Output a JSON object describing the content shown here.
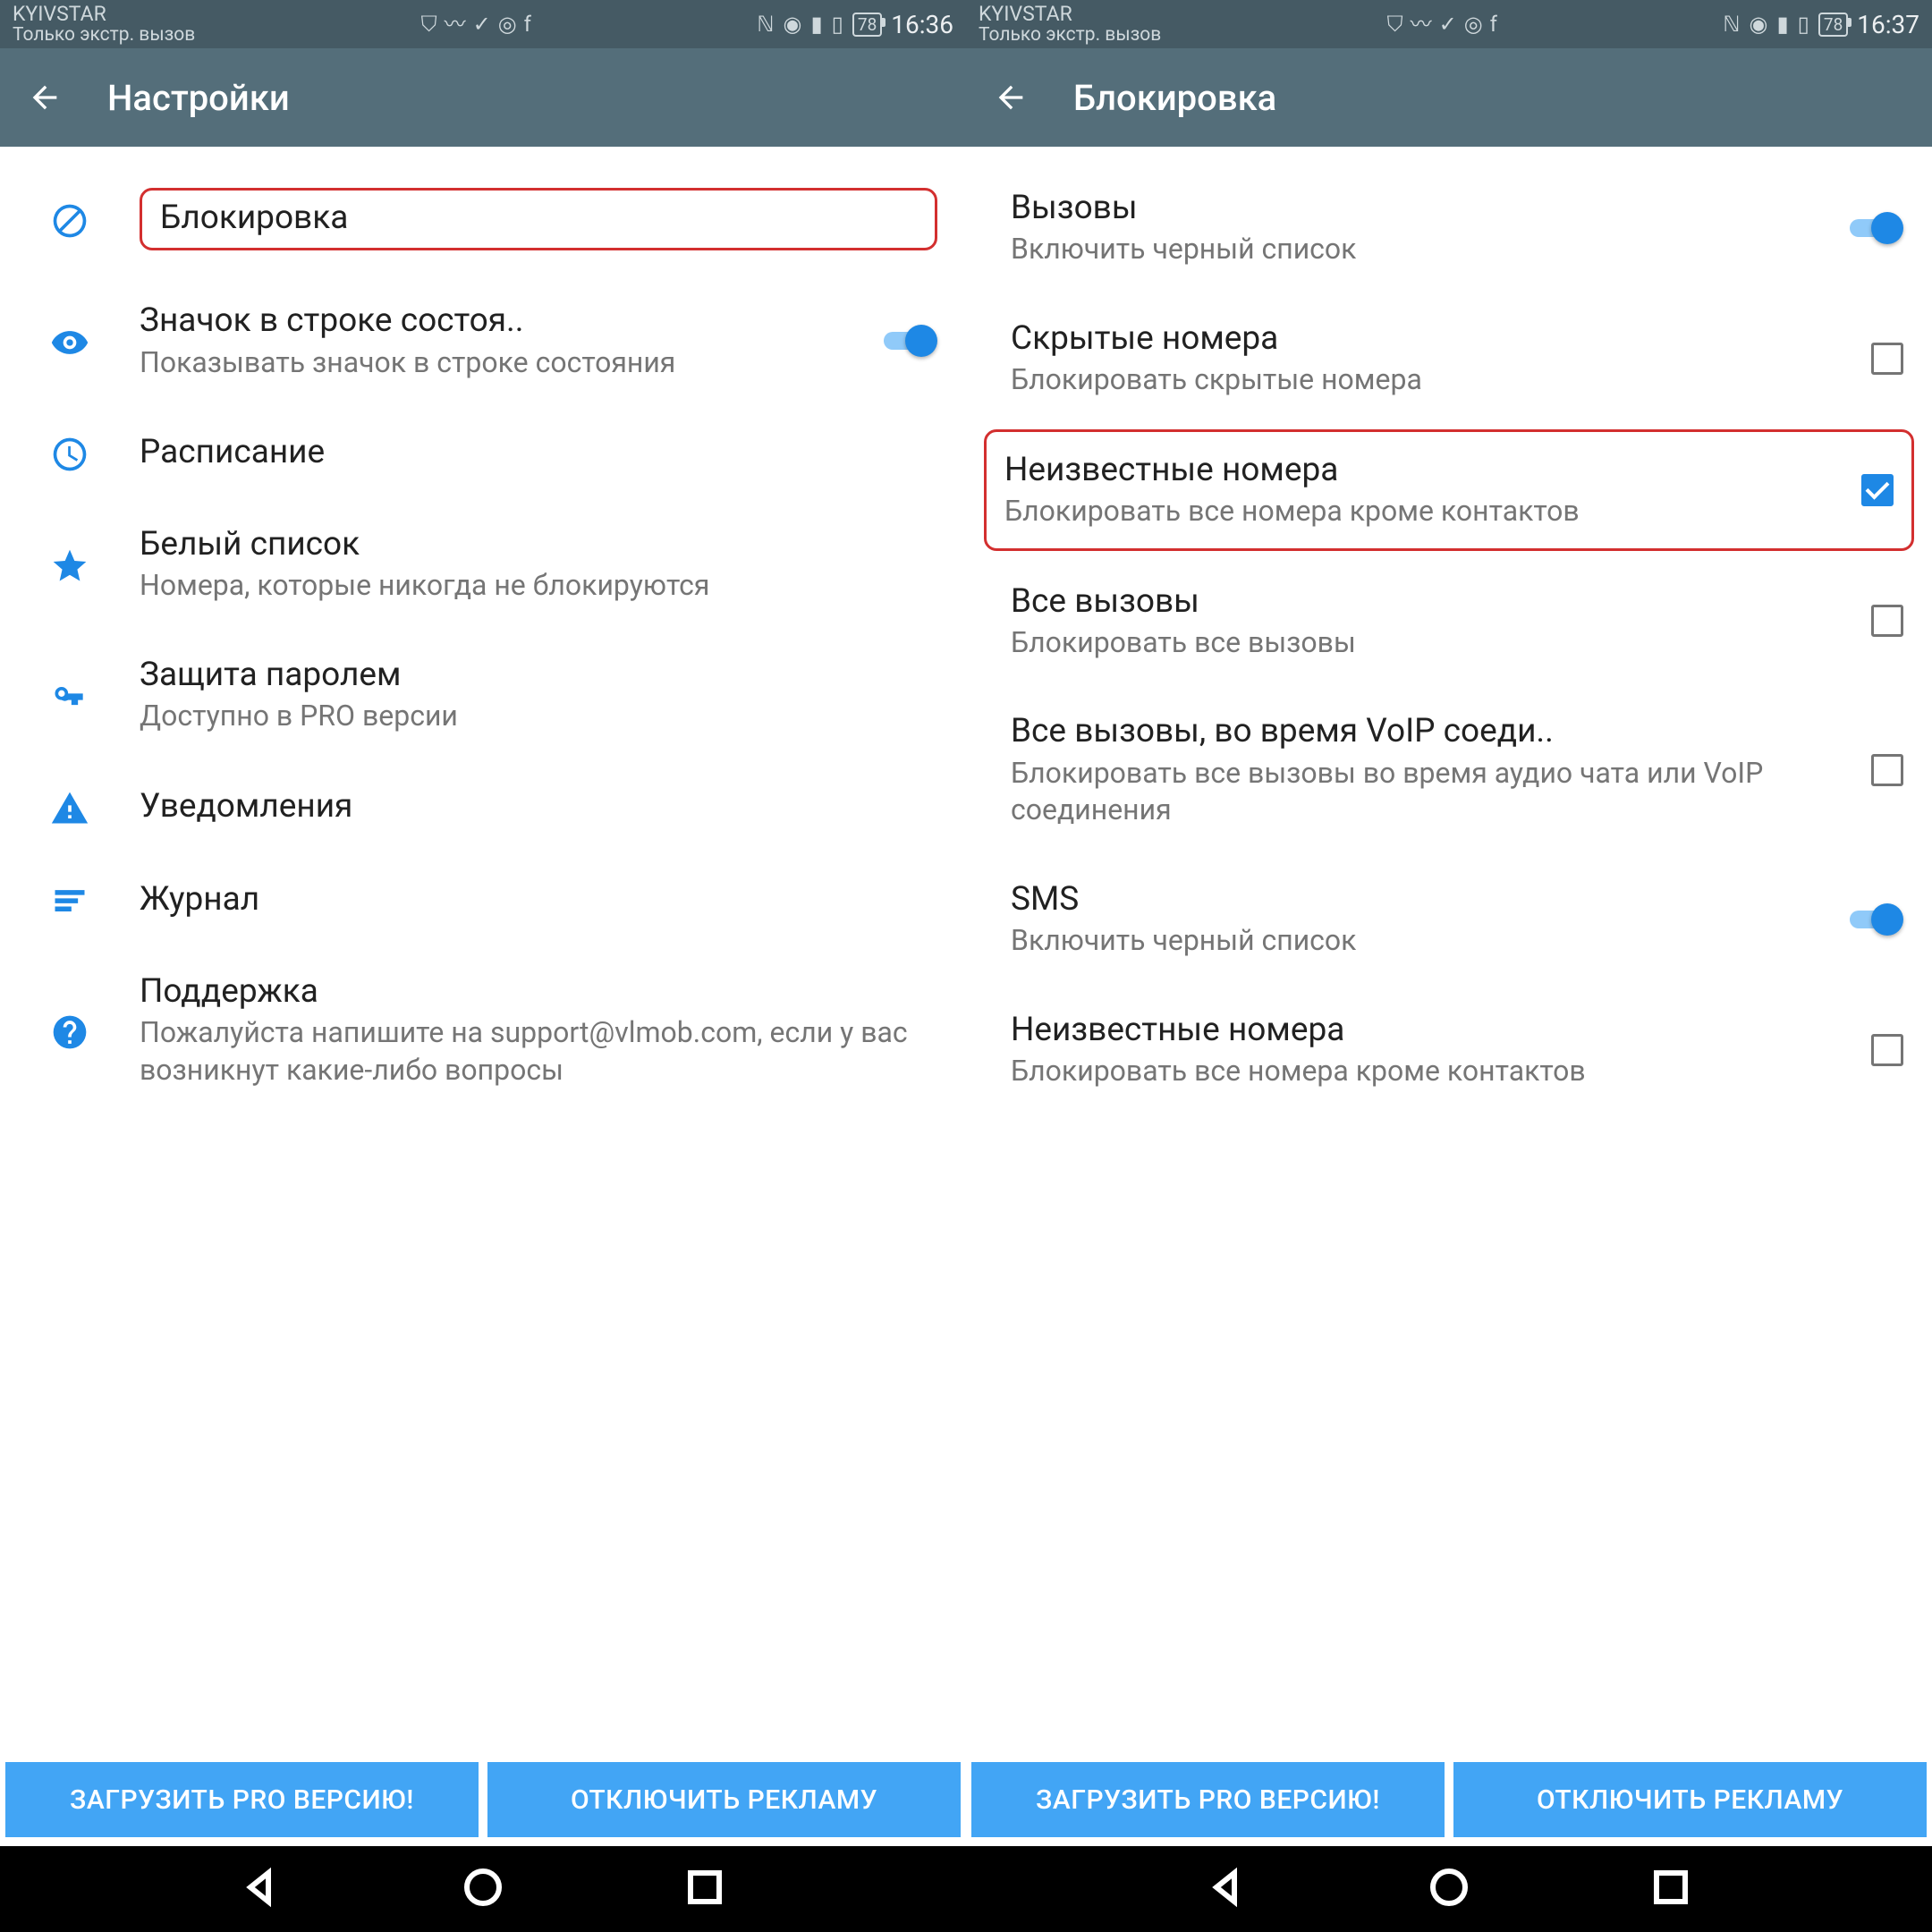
{
  "left": {
    "status": {
      "carrier": "KYIVSTAR",
      "sub": "Только экстр. вызов",
      "battery": "78",
      "time": "16:36"
    },
    "appbar_title": "Настройки",
    "items": [
      {
        "title": "Блокировка",
        "sub": "",
        "icon": "block",
        "highlighted": true
      },
      {
        "title": "Значок в строке состоя..",
        "sub": "Показывать значок в строке состояния",
        "icon": "eye",
        "toggle": true
      },
      {
        "title": "Расписание",
        "sub": "",
        "icon": "clock"
      },
      {
        "title": "Белый список",
        "sub": "Номера, которые никогда не блокируются",
        "icon": "star"
      },
      {
        "title": "Защита паролем",
        "sub": "Доступно в PRO версии",
        "icon": "key"
      },
      {
        "title": "Уведомления",
        "sub": "",
        "icon": "warning"
      },
      {
        "title": "Журнал",
        "sub": "",
        "icon": "list"
      },
      {
        "title": "Поддержка",
        "sub": "Пожалуйста напишите на support@vlmob.com, если у вас возникнут какие-либо вопросы",
        "icon": "help"
      }
    ],
    "promo": {
      "pro": "ЗАГРУЗИТЬ PRO ВЕРСИЮ!",
      "ads": "ОТКЛЮЧИТЬ РЕКЛАМУ"
    }
  },
  "right": {
    "status": {
      "carrier": "KYIVSTAR",
      "sub": "Только экстр. вызов",
      "battery": "78",
      "time": "16:37"
    },
    "appbar_title": "Блокировка",
    "items": [
      {
        "title": "Вызовы",
        "sub": "Включить черный список",
        "toggle": true
      },
      {
        "title": "Скрытые номера",
        "sub": "Блокировать скрытые номера",
        "checkbox": false
      },
      {
        "title": "Неизвестные номера",
        "sub": "Блокировать все номера кроме контактов",
        "checkbox": true,
        "highlighted": true
      },
      {
        "title": "Все вызовы",
        "sub": "Блокировать все вызовы",
        "checkbox": false
      },
      {
        "title": "Все вызовы, во время VoIP соеди..",
        "sub": "Блокировать все вызовы во время аудио чата или VoIP соединения",
        "checkbox": false
      },
      {
        "title": "SMS",
        "sub": "Включить черный список",
        "toggle": true
      },
      {
        "title": "Неизвестные номера",
        "sub": "Блокировать все номера кроме контактов",
        "checkbox": false
      }
    ],
    "promo": {
      "pro": "ЗАГРУЗИТЬ PRO ВЕРСИЮ!",
      "ads": "ОТКЛЮЧИТЬ РЕКЛАМУ"
    }
  }
}
